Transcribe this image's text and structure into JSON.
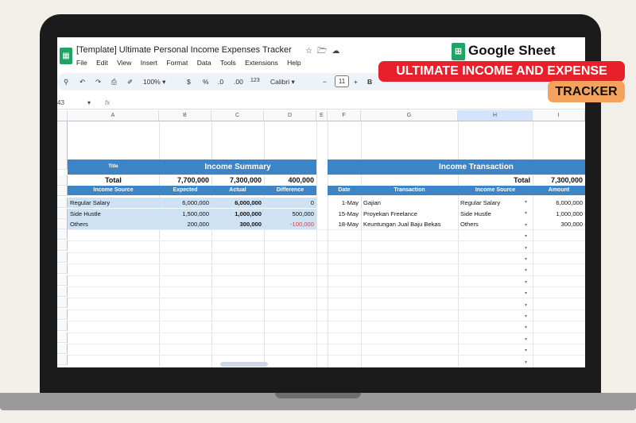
{
  "doc_title": "[Template] Ultimate Personal Income Expenses Tracker",
  "menu": [
    "File",
    "Edit",
    "View",
    "Insert",
    "Format",
    "Data",
    "Tools",
    "Extensions",
    "Help"
  ],
  "toolbar": {
    "zoom": "100%",
    "currency": "$",
    "percent": "%",
    "format_123": "123",
    "font": "Calibri",
    "font_size": "11"
  },
  "cell_ref": "43",
  "fx": "fx",
  "columns": [
    "A",
    "B",
    "C",
    "D",
    "E",
    "F",
    "G",
    "H",
    "I"
  ],
  "summary": {
    "header_title_small": "Title",
    "header": "Income Summary",
    "total_label": "Total",
    "total_expected": "7,700,000",
    "total_actual": "7,300,000",
    "total_difference": "400,000",
    "col_headers": [
      "Income Source",
      "Expected",
      "Actual",
      "Difference"
    ],
    "rows": [
      {
        "source": "Regular Salary",
        "expected": "6,000,000",
        "actual": "6,000,000",
        "difference": "0"
      },
      {
        "source": "Side Hustle",
        "expected": "1,500,000",
        "actual": "1,000,000",
        "difference": "500,000"
      },
      {
        "source": "Others",
        "expected": "200,000",
        "actual": "300,000",
        "difference": "-100,000"
      }
    ]
  },
  "transactions": {
    "header": "Income Transaction",
    "total_label": "Total",
    "total_amount": "7,300,000",
    "col_headers": [
      "Date",
      "Transaction",
      "Income Source",
      "Amount"
    ],
    "rows": [
      {
        "date": "1-May",
        "transaction": "Gajian",
        "source": "Regular Salary",
        "amount": "6,000,000"
      },
      {
        "date": "15-May",
        "transaction": "Proyekan Freelance",
        "source": "Side Hustle",
        "amount": "1,000,000"
      },
      {
        "date": "18-May",
        "transaction": "Keuntungan Jual Baju Bekas",
        "source": "Others",
        "amount": "300,000"
      }
    ]
  },
  "overlay": {
    "brand": "Google Sheet",
    "line1": "ULTIMATE INCOME AND EXPENSE",
    "line2": "TRACKER"
  },
  "colors": {
    "header_blue": "#3d85c6",
    "light_blue": "#cfe2f3",
    "banner_red": "#e8202a",
    "banner_orange": "#f5a35c",
    "sheets_green": "#1fa463"
  }
}
